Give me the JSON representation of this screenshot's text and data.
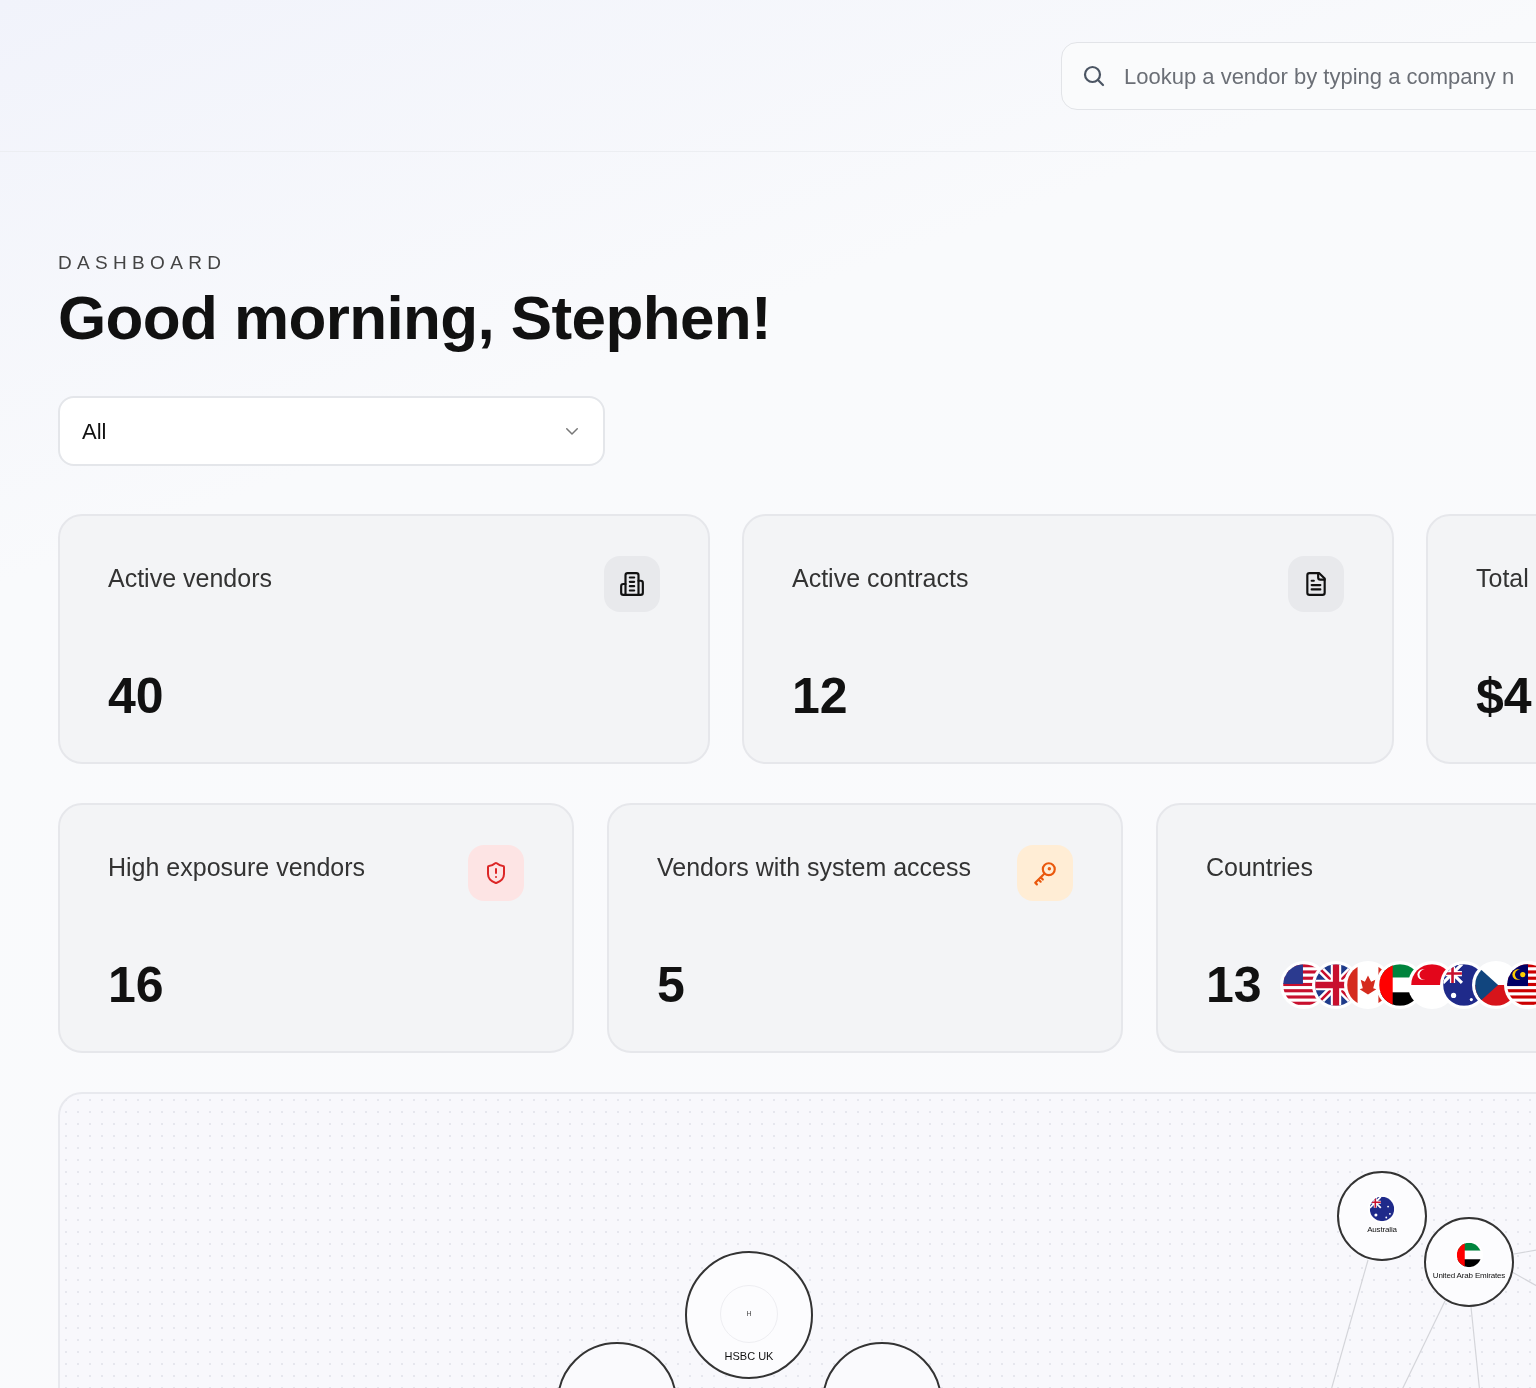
{
  "search": {
    "placeholder": "Lookup a vendor by typing a company n"
  },
  "page": {
    "eyebrow": "DASHBOARD",
    "title": "Good morning, Stephen!"
  },
  "filter": {
    "value": "All"
  },
  "stats_top": [
    {
      "label": "Active vendors",
      "value": "40",
      "kind": "building"
    },
    {
      "label": "Active contracts",
      "value": "12",
      "kind": "document"
    },
    {
      "label": "Total",
      "value": "$4",
      "kind": "none"
    }
  ],
  "stats_bottom": [
    {
      "label": "High exposure vendors",
      "value": "16",
      "kind": "shield"
    },
    {
      "label": "Vendors with system access",
      "value": "5",
      "kind": "key"
    },
    {
      "label": "Countries",
      "value": "13",
      "kind": "flags"
    }
  ],
  "graph": {
    "nodes": [
      {
        "kind": "vendor",
        "initial": "H",
        "label": "HSBC UK"
      },
      {
        "kind": "country",
        "label": "Australia"
      },
      {
        "kind": "country",
        "label": "United Arab Emirates"
      }
    ]
  }
}
